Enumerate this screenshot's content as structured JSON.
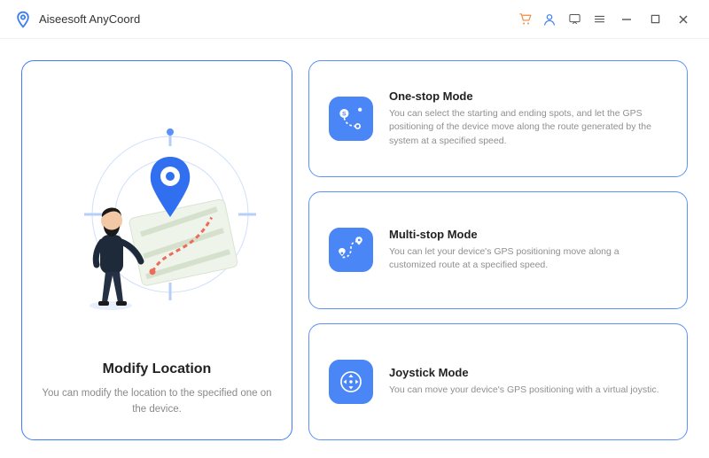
{
  "app": {
    "title": "Aiseesoft AnyCoord"
  },
  "left": {
    "title": "Modify Location",
    "desc": "You can modify the location to the specified one on the device."
  },
  "modes": [
    {
      "title": "One-stop Mode",
      "desc": "You can select the starting and ending spots, and let the GPS positioning of the device move along the route generated by the system at a specified speed."
    },
    {
      "title": "Multi-stop Mode",
      "desc": "You can let your device's GPS positioning move along a customized route at a specified speed."
    },
    {
      "title": "Joystick Mode",
      "desc": "You can move your device's GPS positioning with a virtual joystic."
    }
  ]
}
